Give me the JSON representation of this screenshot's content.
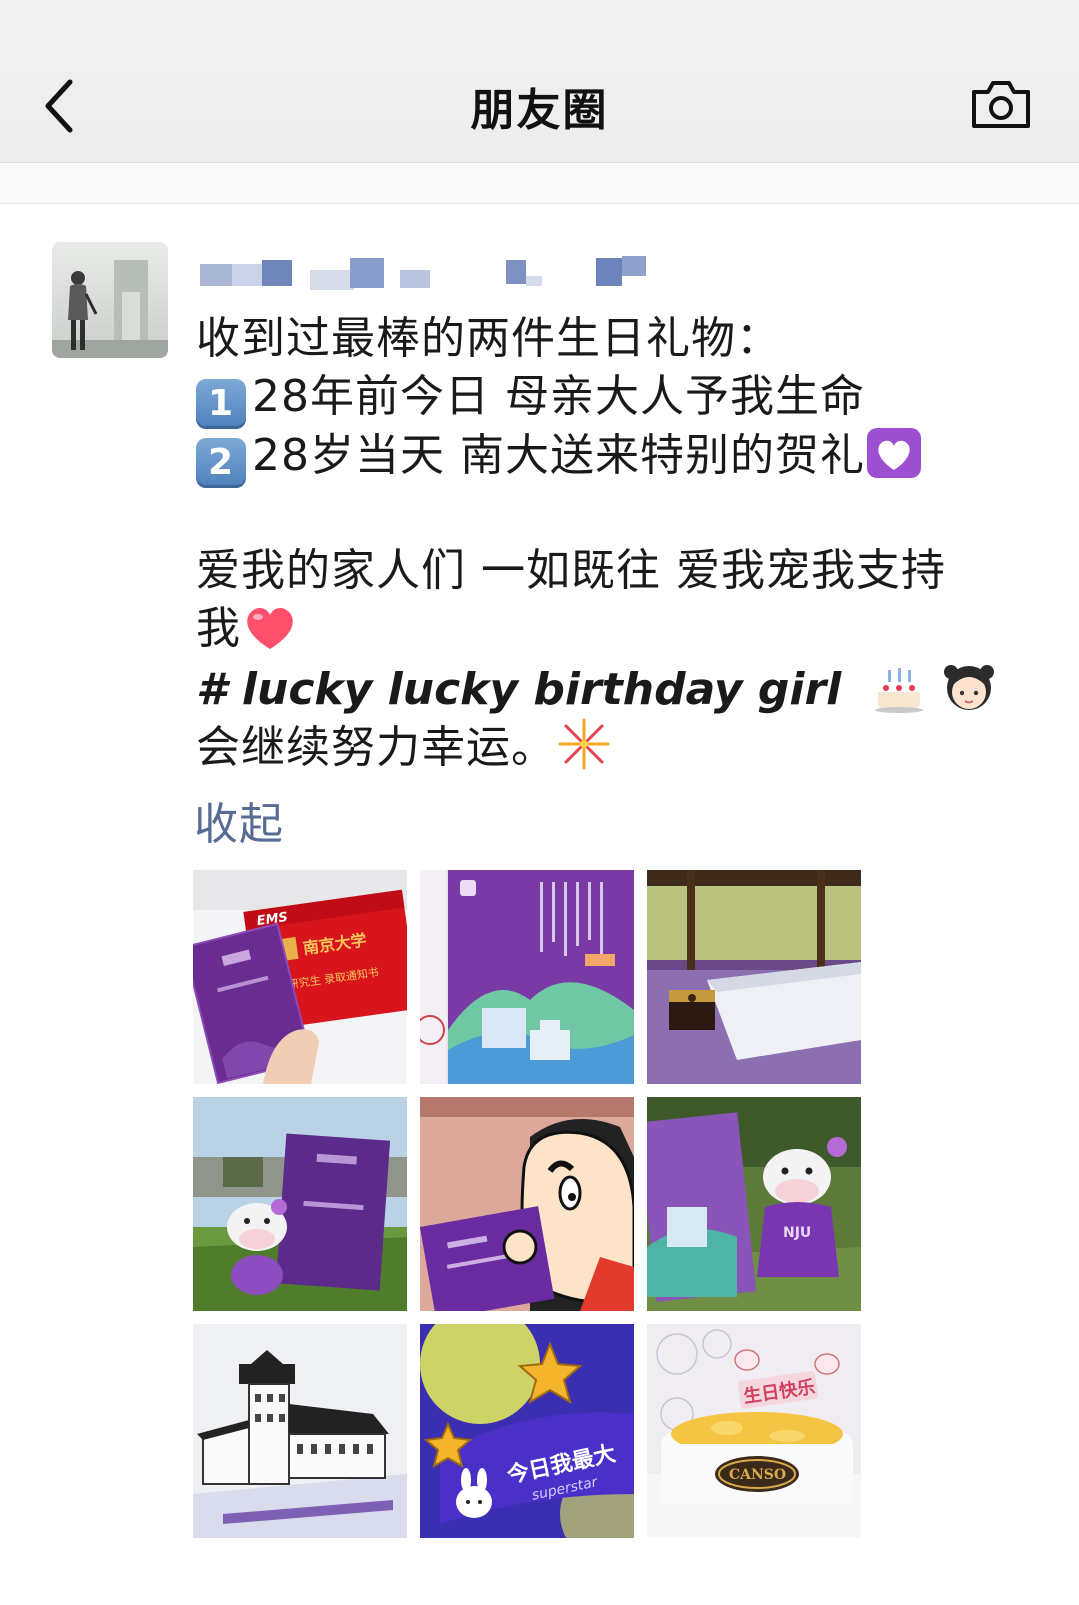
{
  "navbar": {
    "title": "朋友圈",
    "back_icon": "chevron-left-icon",
    "camera_icon": "camera-icon"
  },
  "post": {
    "lines": {
      "l1": "收到过最棒的两件生日礼物：",
      "l2_key": "1",
      "l2": "28年前今日 母亲大人予我生命",
      "l3_key": "2",
      "l3": "28岁当天 南大送来特别的贺礼",
      "l4": "爱我的家人们 一如既往 爱我宠我支持",
      "l5": "我",
      "l6": "# lucky lucky birthday girl",
      "l7": "会继续努力幸运。"
    },
    "emojis": [
      "purple-heart",
      "red-heart",
      "birthday-cake",
      "girl",
      "fireworks"
    ],
    "collapse_label": "收起"
  },
  "photos": {
    "p1": {
      "ems": "EMS",
      "label": "南京大学",
      "notice": "研究生 录取通知书"
    },
    "p6": {
      "badge": "NJU"
    },
    "p8": {
      "text": "今日我最大",
      "sub": "superstar"
    },
    "p9": {
      "text": "生日快乐",
      "brand": "CANSO"
    }
  },
  "colors": {
    "link": "#576b95",
    "nju_purple": "#6a2c91"
  }
}
